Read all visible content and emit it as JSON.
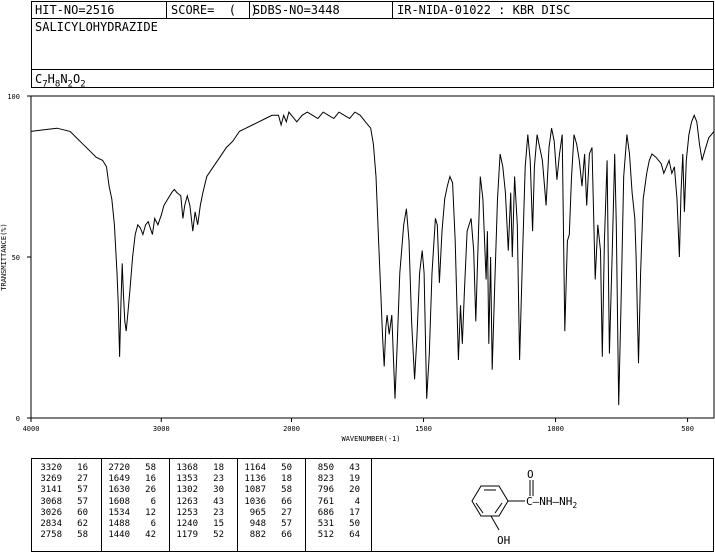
{
  "header": {
    "hit_no": "HIT-NO=2516",
    "score": "SCORE=  (  )",
    "sdbs_no": "SDBS-NO=3448",
    "ir_id": "IR-NIDA-01022 : KBR DISC",
    "compound_name": "SALICYLOHYDRAZIDE",
    "formula": "C7H8N2O2"
  },
  "chart_data": {
    "type": "line",
    "xlabel": "WAVENUMBER(-1)",
    "ylabel": "TRANSMITTANCE(%)",
    "xlim": [
      4000,
      400
    ],
    "ylim": [
      0,
      100
    ],
    "x_ticks": [
      4000,
      3000,
      2000,
      1500,
      1000,
      500
    ],
    "y_ticks": [
      0,
      50,
      100
    ],
    "series": [
      {
        "points": [
          [
            4000,
            89
          ],
          [
            3900,
            89.5
          ],
          [
            3800,
            90
          ],
          [
            3700,
            89
          ],
          [
            3650,
            87
          ],
          [
            3600,
            85
          ],
          [
            3550,
            83
          ],
          [
            3500,
            81
          ],
          [
            3450,
            80
          ],
          [
            3420,
            78
          ],
          [
            3400,
            72
          ],
          [
            3380,
            68
          ],
          [
            3360,
            60
          ],
          [
            3340,
            45
          ],
          [
            3330,
            35
          ],
          [
            3320,
            19
          ],
          [
            3310,
            35
          ],
          [
            3300,
            48
          ],
          [
            3290,
            38
          ],
          [
            3280,
            30
          ],
          [
            3269,
            27
          ],
          [
            3255,
            33
          ],
          [
            3240,
            40
          ],
          [
            3220,
            50
          ],
          [
            3200,
            57
          ],
          [
            3180,
            60
          ],
          [
            3160,
            59
          ],
          [
            3141,
            57
          ],
          [
            3120,
            60
          ],
          [
            3100,
            61
          ],
          [
            3068,
            57
          ],
          [
            3050,
            62
          ],
          [
            3026,
            60
          ],
          [
            3000,
            63
          ],
          [
            2980,
            66
          ],
          [
            2950,
            68
          ],
          [
            2920,
            70
          ],
          [
            2900,
            71
          ],
          [
            2880,
            70
          ],
          [
            2850,
            69
          ],
          [
            2834,
            62
          ],
          [
            2820,
            66
          ],
          [
            2800,
            69
          ],
          [
            2780,
            66
          ],
          [
            2758,
            58
          ],
          [
            2740,
            64
          ],
          [
            2720,
            60
          ],
          [
            2700,
            66
          ],
          [
            2680,
            70
          ],
          [
            2650,
            75
          ],
          [
            2600,
            78
          ],
          [
            2550,
            81
          ],
          [
            2500,
            84
          ],
          [
            2450,
            86
          ],
          [
            2400,
            89
          ],
          [
            2350,
            90
          ],
          [
            2300,
            91
          ],
          [
            2250,
            92
          ],
          [
            2200,
            93
          ],
          [
            2150,
            94
          ],
          [
            2100,
            94
          ],
          [
            2080,
            91
          ],
          [
            2060,
            94
          ],
          [
            2040,
            92
          ],
          [
            2020,
            95
          ],
          [
            2000,
            94
          ],
          [
            1980,
            92
          ],
          [
            1960,
            94
          ],
          [
            1940,
            95
          ],
          [
            1920,
            94
          ],
          [
            1900,
            93
          ],
          [
            1880,
            95
          ],
          [
            1860,
            94
          ],
          [
            1840,
            93
          ],
          [
            1820,
            95
          ],
          [
            1800,
            94
          ],
          [
            1780,
            93
          ],
          [
            1760,
            95
          ],
          [
            1740,
            94
          ],
          [
            1720,
            92
          ],
          [
            1700,
            90
          ],
          [
            1690,
            85
          ],
          [
            1680,
            75
          ],
          [
            1670,
            55
          ],
          [
            1660,
            35
          ],
          [
            1655,
            25
          ],
          [
            1649,
            16
          ],
          [
            1643,
            28
          ],
          [
            1638,
            32
          ],
          [
            1630,
            26
          ],
          [
            1620,
            32
          ],
          [
            1608,
            6
          ],
          [
            1600,
            22
          ],
          [
            1590,
            45
          ],
          [
            1575,
            60
          ],
          [
            1565,
            65
          ],
          [
            1555,
            55
          ],
          [
            1545,
            30
          ],
          [
            1534,
            12
          ],
          [
            1525,
            25
          ],
          [
            1515,
            45
          ],
          [
            1505,
            52
          ],
          [
            1498,
            45
          ],
          [
            1488,
            6
          ],
          [
            1478,
            20
          ],
          [
            1468,
            45
          ],
          [
            1455,
            62
          ],
          [
            1448,
            60
          ],
          [
            1440,
            42
          ],
          [
            1430,
            58
          ],
          [
            1420,
            68
          ],
          [
            1410,
            72
          ],
          [
            1400,
            75
          ],
          [
            1390,
            73
          ],
          [
            1380,
            55
          ],
          [
            1368,
            18
          ],
          [
            1360,
            35
          ],
          [
            1353,
            23
          ],
          [
            1345,
            40
          ],
          [
            1335,
            58
          ],
          [
            1320,
            62
          ],
          [
            1310,
            52
          ],
          [
            1302,
            30
          ],
          [
            1295,
            50
          ],
          [
            1285,
            75
          ],
          [
            1275,
            68
          ],
          [
            1263,
            43
          ],
          [
            1258,
            58
          ],
          [
            1253,
            23
          ],
          [
            1246,
            50
          ],
          [
            1240,
            15
          ],
          [
            1230,
            42
          ],
          [
            1220,
            68
          ],
          [
            1210,
            82
          ],
          [
            1200,
            78
          ],
          [
            1190,
            70
          ],
          [
            1179,
            52
          ],
          [
            1170,
            70
          ],
          [
            1164,
            50
          ],
          [
            1155,
            75
          ],
          [
            1145,
            60
          ],
          [
            1136,
            18
          ],
          [
            1126,
            48
          ],
          [
            1115,
            78
          ],
          [
            1105,
            88
          ],
          [
            1096,
            80
          ],
          [
            1087,
            58
          ],
          [
            1080,
            78
          ],
          [
            1070,
            88
          ],
          [
            1060,
            84
          ],
          [
            1050,
            80
          ],
          [
            1036,
            66
          ],
          [
            1025,
            84
          ],
          [
            1015,
            90
          ],
          [
            1005,
            86
          ],
          [
            995,
            74
          ],
          [
            985,
            82
          ],
          [
            975,
            88
          ],
          [
            965,
            27
          ],
          [
            955,
            55
          ],
          [
            948,
            57
          ],
          [
            940,
            74
          ],
          [
            930,
            88
          ],
          [
            920,
            85
          ],
          [
            910,
            80
          ],
          [
            900,
            72
          ],
          [
            890,
            82
          ],
          [
            882,
            66
          ],
          [
            872,
            82
          ],
          [
            862,
            84
          ],
          [
            850,
            43
          ],
          [
            840,
            60
          ],
          [
            830,
            52
          ],
          [
            823,
            19
          ],
          [
            815,
            55
          ],
          [
            805,
            80
          ],
          [
            796,
            20
          ],
          [
            786,
            50
          ],
          [
            776,
            82
          ],
          [
            770,
            60
          ],
          [
            761,
            4
          ],
          [
            752,
            35
          ],
          [
            742,
            75
          ],
          [
            730,
            88
          ],
          [
            720,
            82
          ],
          [
            710,
            70
          ],
          [
            700,
            62
          ],
          [
            695,
            50
          ],
          [
            686,
            17
          ],
          [
            678,
            45
          ],
          [
            668,
            68
          ],
          [
            655,
            76
          ],
          [
            645,
            80
          ],
          [
            635,
            82
          ],
          [
            620,
            81
          ],
          [
            600,
            79
          ],
          [
            590,
            76
          ],
          [
            580,
            78
          ],
          [
            570,
            80
          ],
          [
            560,
            76
          ],
          [
            550,
            78
          ],
          [
            540,
            68
          ],
          [
            531,
            50
          ],
          [
            525,
            70
          ],
          [
            518,
            82
          ],
          [
            512,
            64
          ],
          [
            505,
            80
          ],
          [
            495,
            88
          ],
          [
            485,
            92
          ],
          [
            475,
            94
          ],
          [
            465,
            92
          ],
          [
            455,
            85
          ],
          [
            445,
            80
          ],
          [
            435,
            83
          ],
          [
            420,
            87
          ],
          [
            410,
            88
          ],
          [
            400,
            89
          ]
        ]
      }
    ]
  },
  "peak_table": [
    [
      [
        "3320",
        "16"
      ],
      [
        "3269",
        "27"
      ],
      [
        "3141",
        "57"
      ],
      [
        "3068",
        "57"
      ],
      [
        "3026",
        "60"
      ],
      [
        "2834",
        "62"
      ],
      [
        "2758",
        "58"
      ]
    ],
    [
      [
        "2720",
        "58"
      ],
      [
        "1649",
        "16"
      ],
      [
        "1630",
        "26"
      ],
      [
        "1608",
        "6"
      ],
      [
        "1534",
        "12"
      ],
      [
        "1488",
        "6"
      ],
      [
        "1440",
        "42"
      ]
    ],
    [
      [
        "1368",
        "18"
      ],
      [
        "1353",
        "23"
      ],
      [
        "1302",
        "30"
      ],
      [
        "1263",
        "43"
      ],
      [
        "1253",
        "23"
      ],
      [
        "1240",
        "15"
      ],
      [
        "1179",
        "52"
      ]
    ],
    [
      [
        "1164",
        "50"
      ],
      [
        "1136",
        "18"
      ],
      [
        "1087",
        "58"
      ],
      [
        "1036",
        "66"
      ],
      [
        "965",
        "27"
      ],
      [
        "948",
        "57"
      ],
      [
        "882",
        "66"
      ]
    ],
    [
      [
        "850",
        "43"
      ],
      [
        "823",
        "19"
      ],
      [
        "796",
        "20"
      ],
      [
        "761",
        "4"
      ],
      [
        "686",
        "17"
      ],
      [
        "531",
        "50"
      ],
      [
        "512",
        "64"
      ]
    ]
  ],
  "structure_labels": {
    "oxygen": "O",
    "hydrazide": "C—NH—NH2",
    "hydroxyl": "OH"
  }
}
